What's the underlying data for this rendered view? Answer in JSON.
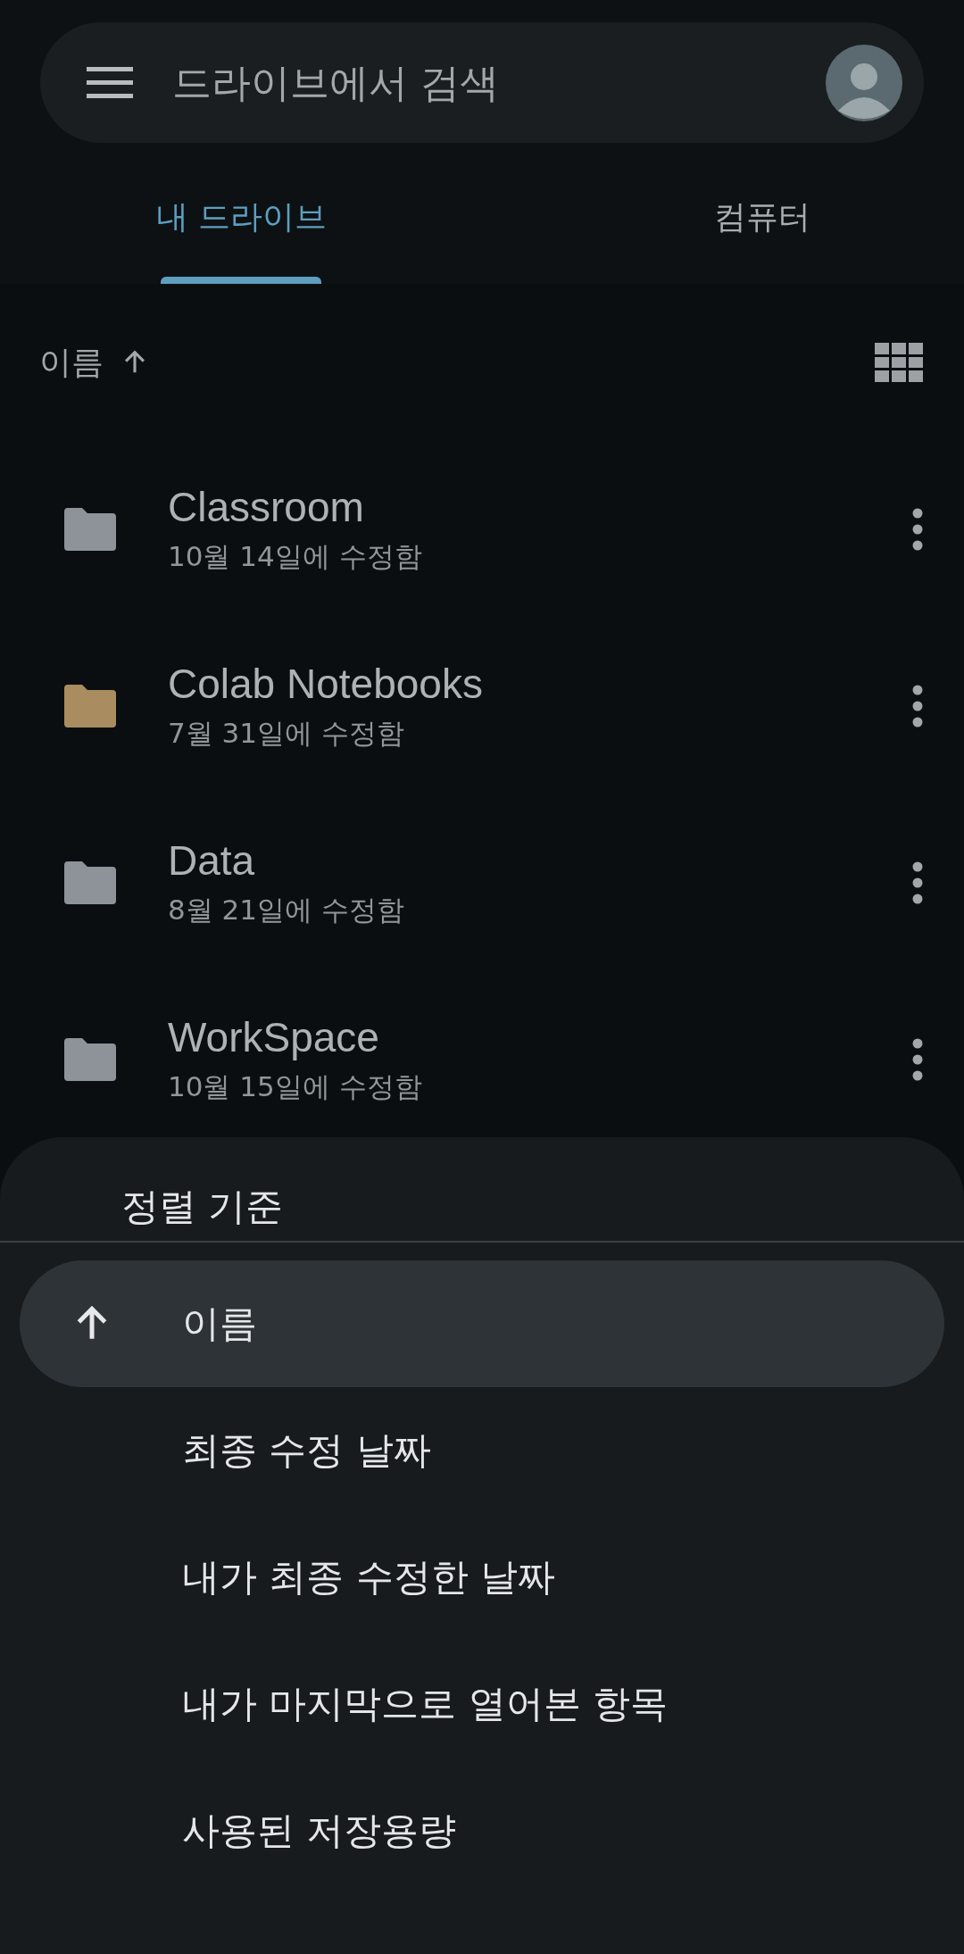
{
  "search": {
    "placeholder": "드라이브에서 검색"
  },
  "tabs": [
    {
      "label": "내 드라이브",
      "selected": true
    },
    {
      "label": "컴퓨터",
      "selected": false
    }
  ],
  "sort_bar": {
    "label": "이름"
  },
  "files": [
    {
      "name": "Classroom",
      "modified": "10월 14일에 수정함",
      "color": "#8e9399"
    },
    {
      "name": "Colab Notebooks",
      "modified": "7월 31일에 수정함",
      "color": "#a98c5f"
    },
    {
      "name": "Data",
      "modified": "8월 21일에 수정함",
      "color": "#8e9399"
    },
    {
      "name": "WorkSpace",
      "modified": "10월 15일에 수정함",
      "color": "#8e9399"
    }
  ],
  "sort_sheet": {
    "title": "정렬 기준",
    "options": [
      {
        "label": "이름",
        "selected": true
      },
      {
        "label": "최종 수정 날짜",
        "selected": false
      },
      {
        "label": "내가 최종 수정한 날짜",
        "selected": false
      },
      {
        "label": "내가 마지막으로 열어본 항목",
        "selected": false
      },
      {
        "label": "사용된 저장용량",
        "selected": false
      }
    ]
  }
}
